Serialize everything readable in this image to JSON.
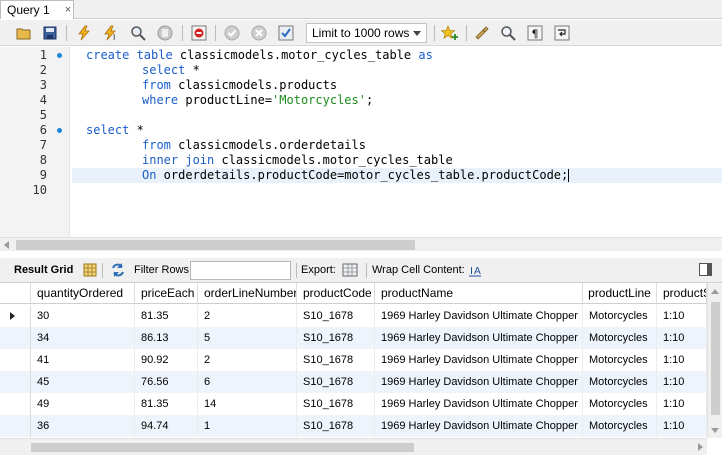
{
  "tab": {
    "label": "Query 1",
    "close": "×"
  },
  "toolbar": {
    "limit_label": "Limit to 1000 rows",
    "icons": [
      "open-file-icon",
      "save-icon",
      "execute-icon",
      "execute-current-icon",
      "explain-icon",
      "stop-icon",
      "toggle-error-icon",
      "commit-icon",
      "rollback-icon",
      "autocommit-icon",
      "add-snippet-icon",
      "beautify-icon",
      "find-icon",
      "invisible-chars-icon",
      "wrap-icon"
    ]
  },
  "editor": {
    "line_numbers": [
      "1",
      "2",
      "3",
      "4",
      "5",
      "6",
      "7",
      "8",
      "9",
      "10"
    ],
    "lines": {
      "l1_kw": "create table",
      "l1_rest": " classicmodels.motor_cycles_table ",
      "l1_as": "as",
      "l2_kw": "select",
      "l2_rest": " *",
      "l3_kw": "from",
      "l3_rest": " classicmodels.products",
      "l4_kw": "where",
      "l4_rest": " productLine=",
      "l4_str": "'Motorcycles'",
      "l4_end": ";",
      "l6_kw": "select",
      "l6_rest": " *",
      "l7_kw": "from",
      "l7_rest": " classicmodels.orderdetails",
      "l8_kw": "inner join",
      "l8_rest": " classicmodels.motor_cycles_table",
      "l9_kw": "On",
      "l9_rest": " orderdetails.productCode=motor_cycles_table.productCode;"
    }
  },
  "result_toolbar": {
    "result_grid": "Result Grid",
    "filter_rows": "Filter Rows:",
    "filter_value": "",
    "export": "Export:",
    "wrap_cell": "Wrap Cell Content:"
  },
  "grid": {
    "columns": [
      "quantityOrdered",
      "priceEach",
      "orderLineNumber",
      "productCode",
      "productName",
      "productLine",
      "productScale"
    ],
    "rows": [
      [
        "30",
        "81.35",
        "2",
        "S10_1678",
        "1969 Harley Davidson Ultimate Chopper",
        "Motorcycles",
        "1:10"
      ],
      [
        "34",
        "86.13",
        "5",
        "S10_1678",
        "1969 Harley Davidson Ultimate Chopper",
        "Motorcycles",
        "1:10"
      ],
      [
        "41",
        "90.92",
        "2",
        "S10_1678",
        "1969 Harley Davidson Ultimate Chopper",
        "Motorcycles",
        "1:10"
      ],
      [
        "45",
        "76.56",
        "6",
        "S10_1678",
        "1969 Harley Davidson Ultimate Chopper",
        "Motorcycles",
        "1:10"
      ],
      [
        "49",
        "81.35",
        "14",
        "S10_1678",
        "1969 Harley Davidson Ultimate Chopper",
        "Motorcycles",
        "1:10"
      ],
      [
        "36",
        "94.74",
        "1",
        "S10_1678",
        "1969 Harley Davidson Ultimate Chopper",
        "Motorcycles",
        "1:10"
      ]
    ]
  }
}
